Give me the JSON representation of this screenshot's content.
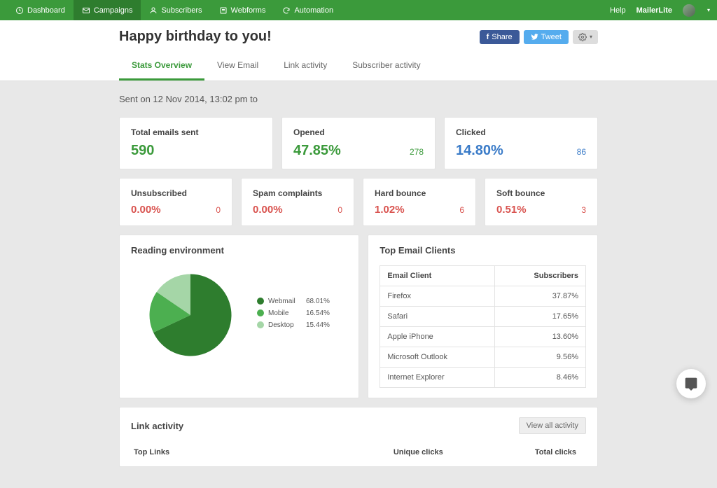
{
  "nav": {
    "items": [
      {
        "label": "Dashboard"
      },
      {
        "label": "Campaigns"
      },
      {
        "label": "Subscribers"
      },
      {
        "label": "Webforms"
      },
      {
        "label": "Automation"
      }
    ],
    "help": "Help",
    "brand": "MailerLite"
  },
  "page": {
    "title": "Happy birthday to you!",
    "share_fb": "Share",
    "tweet": "Tweet"
  },
  "tabs": [
    {
      "label": "Stats Overview"
    },
    {
      "label": "View Email"
    },
    {
      "label": "Link activity"
    },
    {
      "label": "Subscriber activity"
    }
  ],
  "sent_line": "Sent on 12 Nov 2014, 13:02 pm to",
  "summary": [
    {
      "label": "Total emails sent",
      "value": "590",
      "class": "green"
    },
    {
      "label": "Opened",
      "value": "47.85%",
      "count": "278",
      "class": "green",
      "count_class": "green-count"
    },
    {
      "label": "Clicked",
      "value": "14.80%",
      "count": "86",
      "class": "blue",
      "count_class": "blue-count"
    }
  ],
  "secondary": [
    {
      "label": "Unsubscribed",
      "value": "0.00%",
      "count": "0"
    },
    {
      "label": "Spam complaints",
      "value": "0.00%",
      "count": "0"
    },
    {
      "label": "Hard bounce",
      "value": "1.02%",
      "count": "6"
    },
    {
      "label": "Soft bounce",
      "value": "0.51%",
      "count": "3"
    }
  ],
  "reading_env": {
    "title": "Reading environment",
    "items": [
      {
        "label": "Webmail",
        "pct": "68.01%",
        "color": "#2e7d2e"
      },
      {
        "label": "Mobile",
        "pct": "16.54%",
        "color": "#4caf50"
      },
      {
        "label": "Desktop",
        "pct": "15.44%",
        "color": "#a5d6a7"
      }
    ]
  },
  "clients": {
    "title": "Top Email Clients",
    "col1": "Email Client",
    "col2": "Subscribers",
    "rows": [
      {
        "name": "Firefox",
        "pct": "37.87%"
      },
      {
        "name": "Safari",
        "pct": "17.65%"
      },
      {
        "name": "Apple iPhone",
        "pct": "13.60%"
      },
      {
        "name": "Microsoft Outlook",
        "pct": "9.56%"
      },
      {
        "name": "Internet Explorer",
        "pct": "8.46%"
      }
    ]
  },
  "link_activity": {
    "title": "Link activity",
    "view_all": "View all activity",
    "col1": "Top Links",
    "col2": "Unique clicks",
    "col3": "Total clicks"
  },
  "chart_data": {
    "type": "pie",
    "title": "Reading environment",
    "categories": [
      "Webmail",
      "Mobile",
      "Desktop"
    ],
    "values": [
      68.01,
      16.54,
      15.44
    ],
    "colors": [
      "#2e7d2e",
      "#4caf50",
      "#a5d6a7"
    ]
  }
}
